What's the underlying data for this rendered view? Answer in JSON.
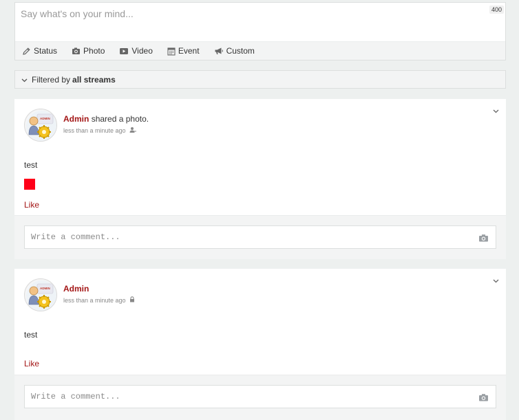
{
  "composer": {
    "placeholder": "Say what's on your mind...",
    "char_count": "400",
    "tabs": [
      {
        "label": "Status",
        "icon": "pencil-icon"
      },
      {
        "label": "Photo",
        "icon": "camera-icon"
      },
      {
        "label": "Video",
        "icon": "video-icon"
      },
      {
        "label": "Event",
        "icon": "calendar-icon"
      },
      {
        "label": "Custom",
        "icon": "megaphone-icon"
      }
    ]
  },
  "filter": {
    "prefix": "Filtered by",
    "value": "all streams",
    "icon": "chevron-down-icon"
  },
  "posts": [
    {
      "author": "Admin",
      "action": "shared a photo.",
      "time": "less than a minute ago",
      "privacy_icon": "user-icon",
      "text": "test",
      "has_photo": true,
      "like_label": "Like",
      "comment_placeholder": "Write a comment..."
    },
    {
      "author": "Admin",
      "action": "",
      "time": "less than a minute ago",
      "privacy_icon": "lock-icon",
      "text": "test",
      "has_photo": false,
      "like_label": "Like",
      "comment_placeholder": "Write a comment..."
    }
  ],
  "colors": {
    "background": "#edf0ef",
    "author": "#a31616",
    "photo": "#ff0019"
  }
}
